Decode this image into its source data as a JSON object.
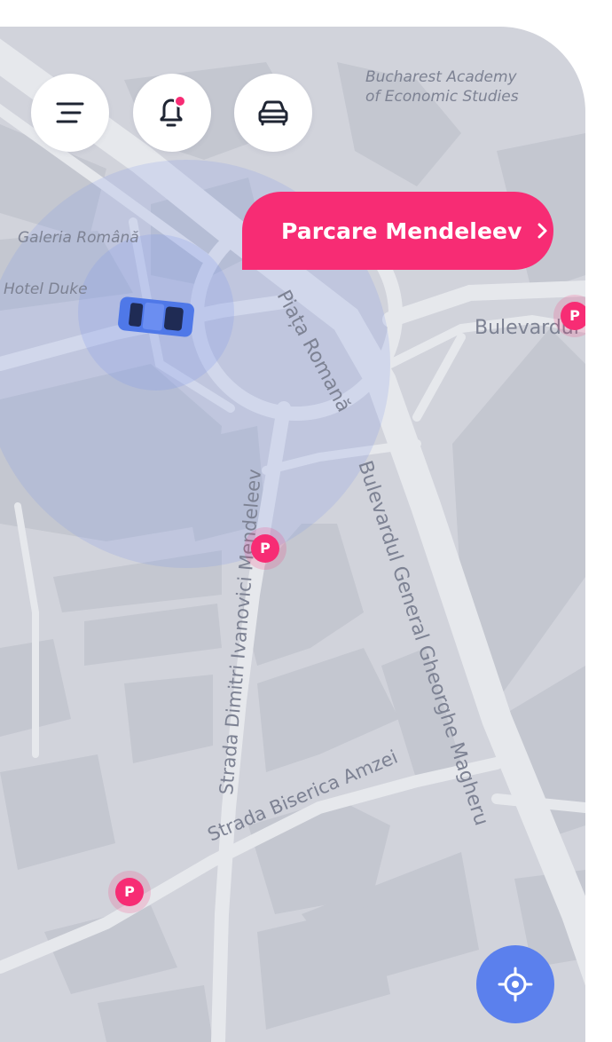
{
  "map": {
    "labels": {
      "academy_line1": "Bucharest Academy",
      "academy_line2": "of Economic Studies",
      "galeria": "Galeria Română",
      "hotel": "Hotel Duke",
      "piata": "Piața Romană",
      "bulevardul_general": "Bulevardul General Gheorghe Magheru",
      "strada_dimitri": "Strada Dimitri Ivanovici Mendeleev",
      "strada_biserica": "Strada Biserica Amzei",
      "bulevard_right": "Bulevardul"
    },
    "colors": {
      "background": "#d1d3db",
      "road": "#e6e8ec",
      "building": "#c4c7d0",
      "accent": "#f72c74",
      "vehicle": "#4f78e8",
      "locate": "#5b80ed"
    }
  },
  "top_buttons": {
    "menu_icon": "menu-icon",
    "notifications_icon": "bell-icon",
    "car_icon": "car-icon"
  },
  "parking_callout": {
    "label": "Parcare Mendeleev",
    "chevron_icon": "chevron-right-icon"
  },
  "parking_markers": [
    {
      "label": "P"
    },
    {
      "label": "P"
    },
    {
      "label": "P"
    }
  ],
  "locate_button": {
    "icon": "locate-icon"
  }
}
